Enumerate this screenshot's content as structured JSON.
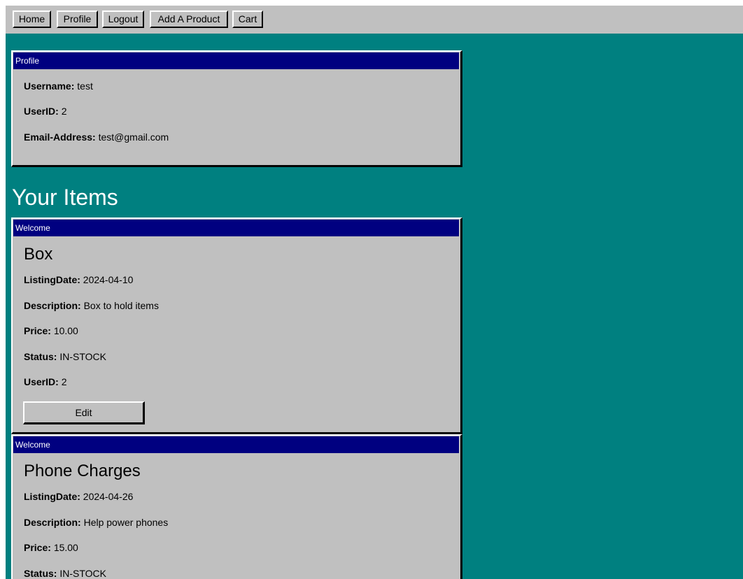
{
  "nav": {
    "items": [
      {
        "label": "Home"
      },
      {
        "label": "Profile"
      },
      {
        "label": "Logout"
      },
      {
        "label": "Add A Product"
      },
      {
        "label": "Cart"
      }
    ]
  },
  "profile": {
    "window_title": "Profile",
    "username_label": "Username:",
    "username": "test",
    "userid_label": "UserID:",
    "userid": "2",
    "email_label": "Email-Address:",
    "email": "test@gmail.com"
  },
  "items_heading": "Your Items",
  "items": [
    {
      "window_title": "Welcome",
      "name": "Box",
      "listing_date_label": "ListingDate:",
      "listing_date": "2024-04-10",
      "description_label": "Description:",
      "description": "Box to hold items",
      "price_label": "Price:",
      "price": "10.00",
      "status_label": "Status:",
      "status": "IN-STOCK",
      "userid_label": "UserID:",
      "userid": "2",
      "edit_label": "Edit"
    },
    {
      "window_title": "Welcome",
      "name": "Phone Charges",
      "listing_date_label": "ListingDate:",
      "listing_date": "2024-04-26",
      "description_label": "Description:",
      "description": "Help power phones",
      "price_label": "Price:",
      "price": "15.00",
      "status_label": "Status:",
      "status": "IN-STOCK"
    }
  ],
  "colors": {
    "background": "#008080",
    "panel": "#c0c0c0",
    "titlebar": "#000080"
  }
}
